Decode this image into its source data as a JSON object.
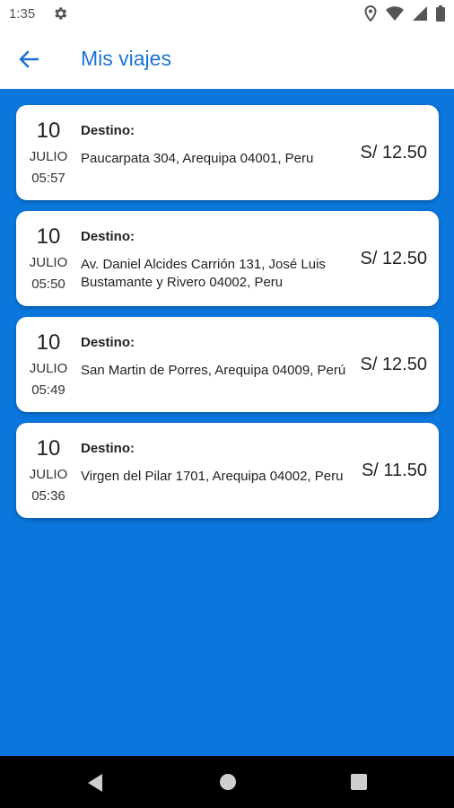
{
  "status_bar": {
    "time": "1:35",
    "icons": [
      "gear-icon",
      "location-icon",
      "wifi-icon",
      "signal-icon",
      "battery-icon"
    ]
  },
  "app_bar": {
    "title": "Mis viajes",
    "back_icon": "arrow-left-icon"
  },
  "colors": {
    "primary": "#0b76dc",
    "title": "#1a73d1",
    "card": "#ffffff"
  },
  "trips": [
    {
      "day": "10",
      "month": "JULIO",
      "time": "05:57",
      "dest_label": "Destino:",
      "address": "Paucarpata 304, Arequipa 04001, Peru",
      "price": "S/ 12.50"
    },
    {
      "day": "10",
      "month": "JULIO",
      "time": "05:50",
      "dest_label": "Destino:",
      "address": "Av. Daniel Alcides Carrión 131, José Luis Bustamante y Rivero 04002, Peru",
      "price": "S/ 12.50"
    },
    {
      "day": "10",
      "month": "JULIO",
      "time": "05:49",
      "dest_label": "Destino:",
      "address": "San Martin de Porres, Arequipa 04009, Perú",
      "price": "S/ 12.50"
    },
    {
      "day": "10",
      "month": "JULIO",
      "time": "05:36",
      "dest_label": "Destino:",
      "address": "Virgen del Pilar 1701, Arequipa 04002, Peru",
      "price": "S/ 11.50"
    }
  ],
  "nav_bar": {
    "icons": [
      "nav-back-icon",
      "nav-home-icon",
      "nav-recents-icon"
    ]
  }
}
